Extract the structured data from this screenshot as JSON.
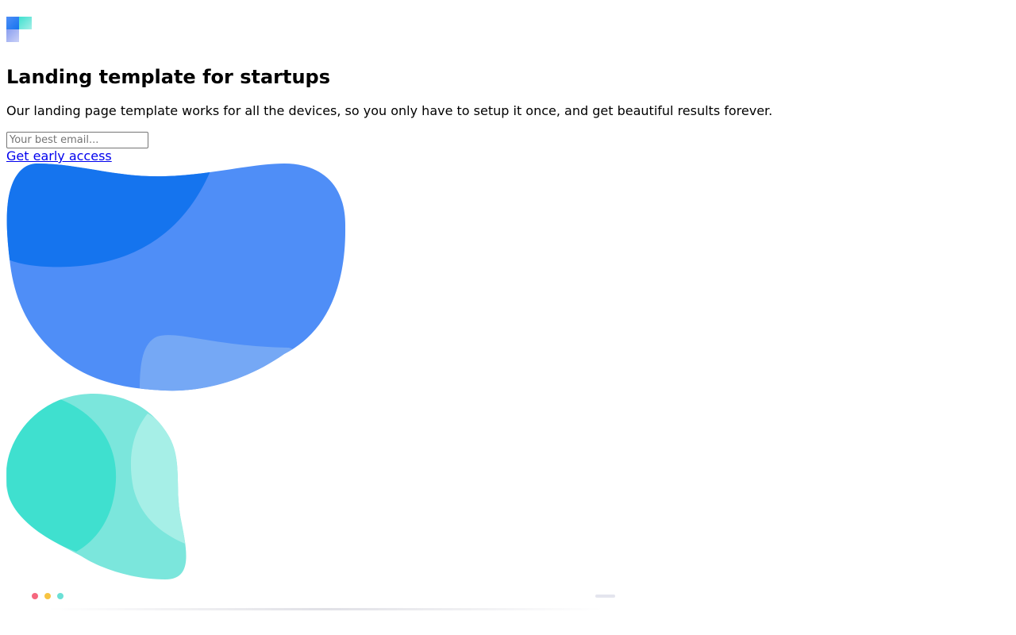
{
  "hero": {
    "title": "Landing template for startups",
    "paragraph": "Our landing page template works for all the devices, so you only have to setup it once, and get beautiful results forever."
  },
  "signup": {
    "email_placeholder": "Your best email...",
    "email_value": "",
    "cta_label": "Get early access"
  },
  "logo": {
    "icon": "logo-squares-icon",
    "colors": [
      "#1a73e8",
      "#7ed6dc",
      "#a9b4f0"
    ]
  },
  "illustration": {
    "blue_blob_colors": [
      "#4f8ef7",
      "#1574ee",
      "#75a8f5"
    ],
    "teal_blob_colors": [
      "#7be6dc",
      "#3fe0cf",
      "#a6efe7"
    ]
  },
  "window_mockup": {
    "dot_colors": [
      "#f5677e",
      "#f7c441",
      "#6be0d6"
    ],
    "bar_color": "#e4e5ee"
  }
}
